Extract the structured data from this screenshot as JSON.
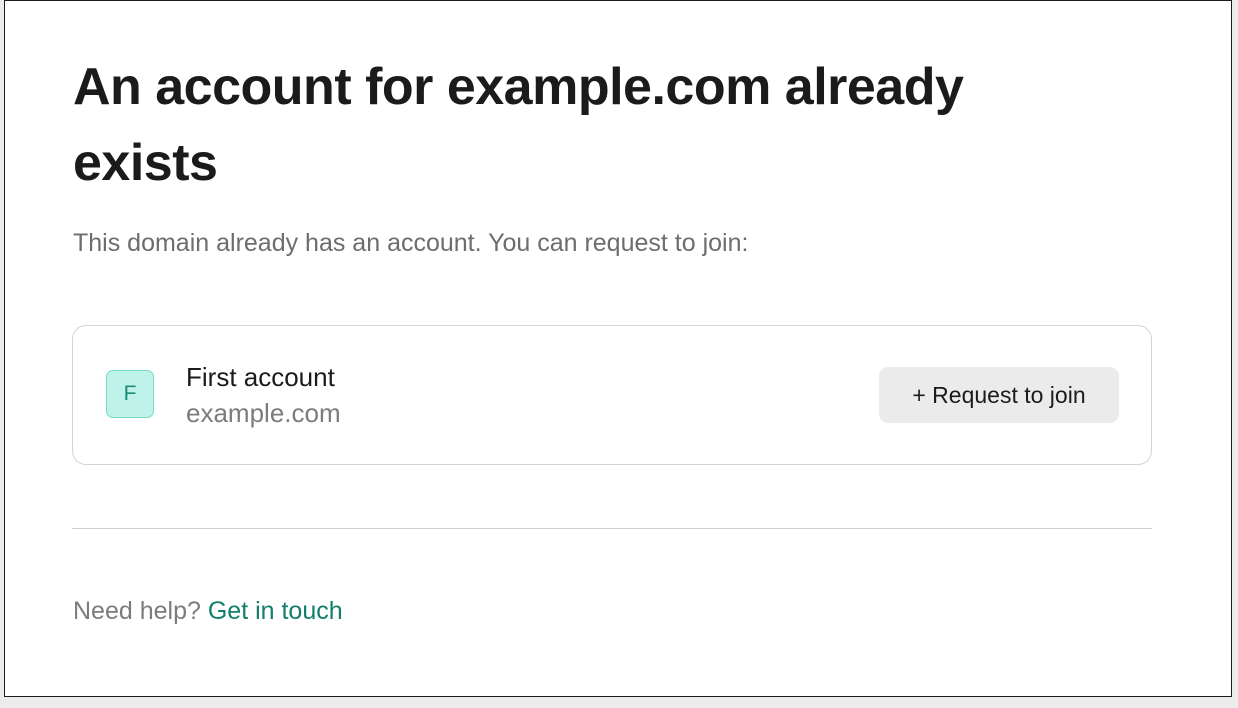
{
  "page": {
    "title": "An account for example.com already exists",
    "subtitle": "This domain already has an account. You can request to join:"
  },
  "account": {
    "avatar_letter": "F",
    "name": "First account",
    "domain": "example.com",
    "join_button_label": "+ Request to join"
  },
  "footer": {
    "help_text": "Need help?",
    "help_link_label": "Get in touch"
  },
  "colors": {
    "accent": "#107f6b",
    "avatar_background": "#bff3ea",
    "avatar_border": "#74dcc8",
    "button_background": "#ebebeb"
  }
}
